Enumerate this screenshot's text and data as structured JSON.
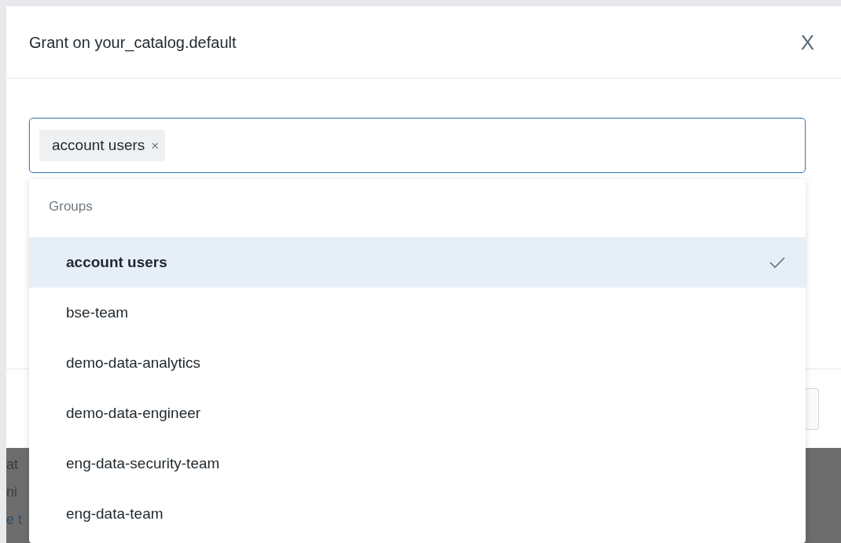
{
  "dialog": {
    "title": "Grant on your_catalog.default",
    "close_label": "X"
  },
  "principal_field": {
    "tags": [
      {
        "label": "account users",
        "remove_label": "×"
      }
    ]
  },
  "dropdown": {
    "section": "Groups",
    "items": [
      {
        "label": "account users",
        "selected": true
      },
      {
        "label": "bse-team",
        "selected": false
      },
      {
        "label": "demo-data-analytics",
        "selected": false
      },
      {
        "label": "demo-data-engineer",
        "selected": false
      },
      {
        "label": "eng-data-security-team",
        "selected": false
      },
      {
        "label": "eng-data-team",
        "selected": false
      }
    ]
  },
  "background_page": {
    "fragments": [
      {
        "text": "at",
        "kind": "text"
      },
      {
        "text": "ni",
        "kind": "text"
      },
      {
        "text": "e t",
        "kind": "link"
      }
    ]
  }
}
